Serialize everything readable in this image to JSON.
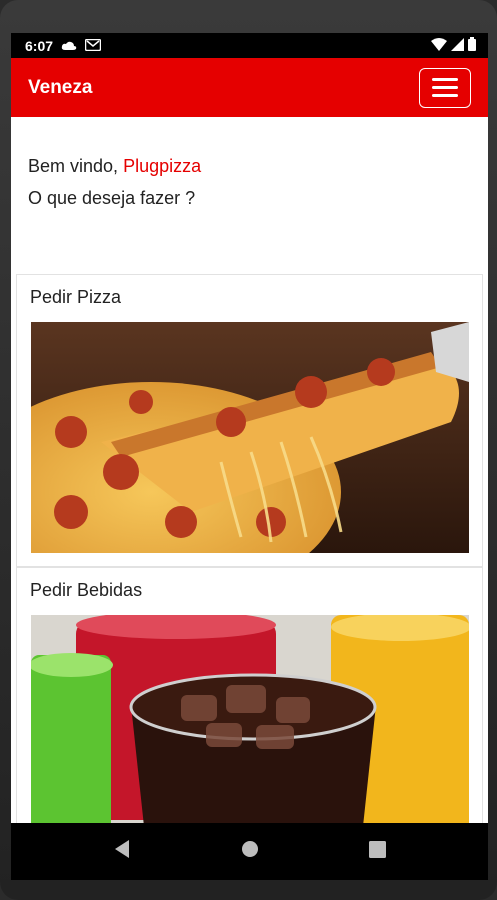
{
  "status_bar": {
    "time": "6:07"
  },
  "app_bar": {
    "title": "Veneza"
  },
  "welcome": {
    "greeting": "Bem vindo,",
    "username": "Plugpizza",
    "question": "O que deseja fazer ?"
  },
  "cards": [
    {
      "title": "Pedir Pizza"
    },
    {
      "title": "Pedir Bebidas"
    }
  ],
  "colors": {
    "brand": "#e50000",
    "background": "#ffffff"
  },
  "icons": {
    "menu": "hamburger-menu-icon",
    "back": "back-triangle-icon",
    "home": "home-circle-icon",
    "recents": "recents-square-icon"
  }
}
